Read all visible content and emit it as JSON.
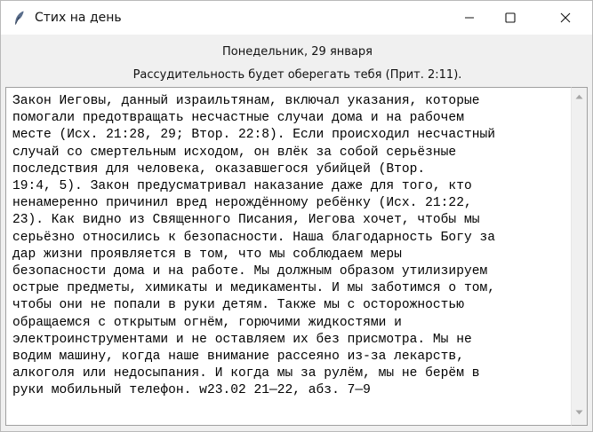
{
  "window": {
    "title": "Стих на день",
    "icon": "feather-icon",
    "controls": [
      "minimize-icon",
      "maximize-icon",
      "close-icon"
    ]
  },
  "header": {
    "date": "Понедельник, 29 января",
    "verse": "Рассудительность будет оберегать тебя (Прит. 2:11)."
  },
  "content": {
    "lines": [
      "Закон Иеговы, данный израильтянам, включал указания, которые",
      "помогали предотвращать несчастные случаи дома и на рабочем",
      "месте (Исх. 21:28, 29; Втор. 22:8). Если происходил несчастный",
      "случай со смертельным исходом, он влёк за собой серьёзные",
      "последствия для человека, оказавшегося убийцей (Втор.",
      "19:4, 5). Закон предусматривал наказание даже для того, кто",
      "ненамеренно причинил вред нерождённому ребёнку (Исх. 21:22,",
      "23). Как видно из Священного Писания, Иегова хочет, чтобы мы",
      "серьёзно относились к безопасности. Наша благодарность Богу за",
      "дар жизни проявляется в том, что мы соблюдаем меры",
      "безопасности дома и на работе. Мы должным образом утилизируем",
      "острые предметы, химикаты и медикаменты. И мы заботимся о том,",
      "чтобы они не попали в руки детям. Также мы с осторожностью",
      "обращаемся с открытым огнём, горючими жидкостями и",
      "электроинструментами и не оставляем их без присмотра. Мы не",
      "водим машину, когда наше внимание рассеяно из-за лекарств,",
      "алкоголя или недосыпания. И когда мы за рулём, мы не берём в",
      "руки мобильный телефон. w23.02 21—22, абз. 7—9"
    ]
  },
  "scrollbar": {
    "up_icon": "scroll-up-arrow-icon",
    "down_icon": "scroll-down-arrow-icon"
  }
}
